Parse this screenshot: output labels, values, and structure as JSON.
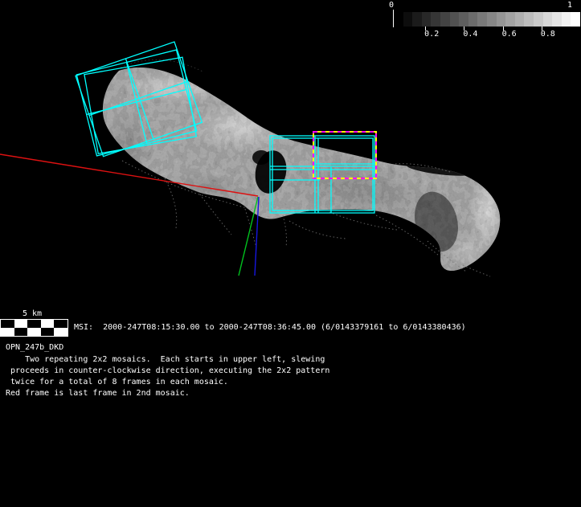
{
  "colorbar": {
    "min_label": "0",
    "max_label": "1",
    "tick_labels": [
      "0.2",
      "0.4",
      "0.6",
      "0.8"
    ],
    "steps": 20
  },
  "scalebar": {
    "label": "5 km",
    "segments": 5,
    "rows": 2
  },
  "status_line": "MSI:  2000-247T08:15:30.00 to 2000-247T08:36:45.00 (6/0143379161 to 6/0143380436)",
  "sequence": {
    "name": "OPN_247b_DKD",
    "description_lines": [
      "    Two repeating 2x2 mosaics.  Each starts in upper left, slewing",
      " proceeds in counter-clockwise direction, executing the 2x2 pattern",
      " twice for a total of 8 frames in each mosaic.",
      "Red frame is last frame in 2nd mosaic."
    ]
  },
  "legend_colors": {
    "mosaic_frame": "#00ffff",
    "last_frame_dash_a": "#ff00ff",
    "last_frame_dash_b": "#ffff00",
    "axis_red": "#dd1111",
    "axis_green": "#00c21e",
    "axis_blue": "#1616e0"
  }
}
